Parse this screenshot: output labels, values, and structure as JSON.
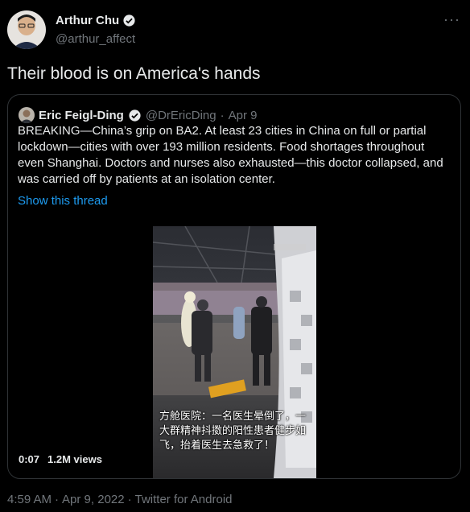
{
  "author": {
    "name": "Arthur Chu",
    "handle": "@arthur_affect",
    "more_label": "···"
  },
  "tweet": {
    "text": "Their blood is on America's hands",
    "time": "4:59 AM",
    "sep1": "·",
    "date": "Apr 9, 2022",
    "sep2": "·",
    "source": "Twitter for Android"
  },
  "quoted": {
    "name": "Eric Feigl-Ding",
    "handle": "@DrEricDing",
    "sep": "·",
    "date": "Apr 9",
    "text": "BREAKING—China’s grip on BA2. At least 23 cities in China on full or partial lockdown—cities with over 193 million residents. Food shortages throughout even Shanghai. Doctors and nurses also exhausted—this doctor collapsed, and was carried off by patients at an isolation center.",
    "show_thread": "Show this thread",
    "video": {
      "caption": "方舱医院：一名医生晕倒了，一大群精神抖擞的阳性患者健步如飞，抬着医生去急救了！",
      "duration": "0:07",
      "views": "1.2M views"
    }
  },
  "colors": {
    "background": "#000000",
    "text": "#e7e9ea",
    "secondary": "#71767b",
    "link": "#1d9bf0",
    "verified": "#e7e9ea",
    "border": "#2f3336"
  },
  "icons": {
    "verified": "verified-badge-icon",
    "more": "more-horizontal-icon"
  }
}
